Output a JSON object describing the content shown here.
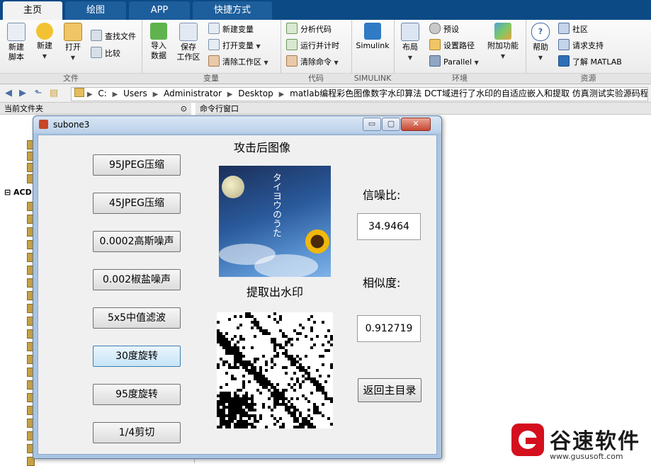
{
  "tabs": [
    {
      "label": "主页",
      "active": true
    },
    {
      "label": "绘图",
      "active": false
    },
    {
      "label": "APP",
      "active": false
    },
    {
      "label": "快捷方式",
      "active": false
    }
  ],
  "ribbon": {
    "file": {
      "section": "文件",
      "new_script": "新建\n脚本",
      "new": "新建",
      "open": "打开",
      "find_files": "查找文件",
      "compare": "比较"
    },
    "variable": {
      "section": "变量",
      "import": "导入\n数据",
      "save_ws": "保存\n工作区",
      "new_var": "新建变量",
      "open_var": "打开变量",
      "clear_ws": "清除工作区"
    },
    "code": {
      "section": "代码",
      "analyze": "分析代码",
      "run_time": "运行并计时",
      "clear_cmd": "清除命令"
    },
    "simulink": {
      "section": "SIMULINK",
      "simulink": "Simulink"
    },
    "env": {
      "section": "环境",
      "layout": "布局",
      "prefs": "预设",
      "set_path": "设置路径",
      "parallel": "Parallel",
      "addons": "附加功能"
    },
    "resources": {
      "section": "资源",
      "help": "帮助",
      "community": "社区",
      "support": "请求支持",
      "learn": "了解 MATLAB"
    }
  },
  "address": {
    "crumbs": [
      "C:",
      "Users",
      "Administrator",
      "Desktop",
      "matlab编程彩色图像数字水印算法 DCT域进行了水印的自适应嵌入和提取 仿真测试实验源码程序+"
    ]
  },
  "panes": {
    "left_title": "当前文件夹",
    "right_title": "命令行窗口",
    "acd": "ACD"
  },
  "figure": {
    "title": "subone3",
    "min_btn": "▭",
    "restore_btn": "▢",
    "close_btn": "✕",
    "attacked_title": "攻击后图像",
    "extracted_title": "提取出水印",
    "snr_label": "信噪比:",
    "snr_value": "34.9464",
    "sim_label": "相似度:",
    "sim_value": "0.912719",
    "return_btn": "返回主目录",
    "attack_buttons": [
      "95JPEG压缩",
      "45JPEG压缩",
      "0.0002高斯噪声",
      "0.002椒盐噪声",
      "5x5中值滤波",
      "30度旋转",
      "95度旋转",
      "1/4剪切"
    ],
    "image_caption": "タイヨウのうた"
  },
  "logo": {
    "name": "谷速软件",
    "url": "www.gususoft.com",
    "brand_color": "#d40f1e"
  }
}
